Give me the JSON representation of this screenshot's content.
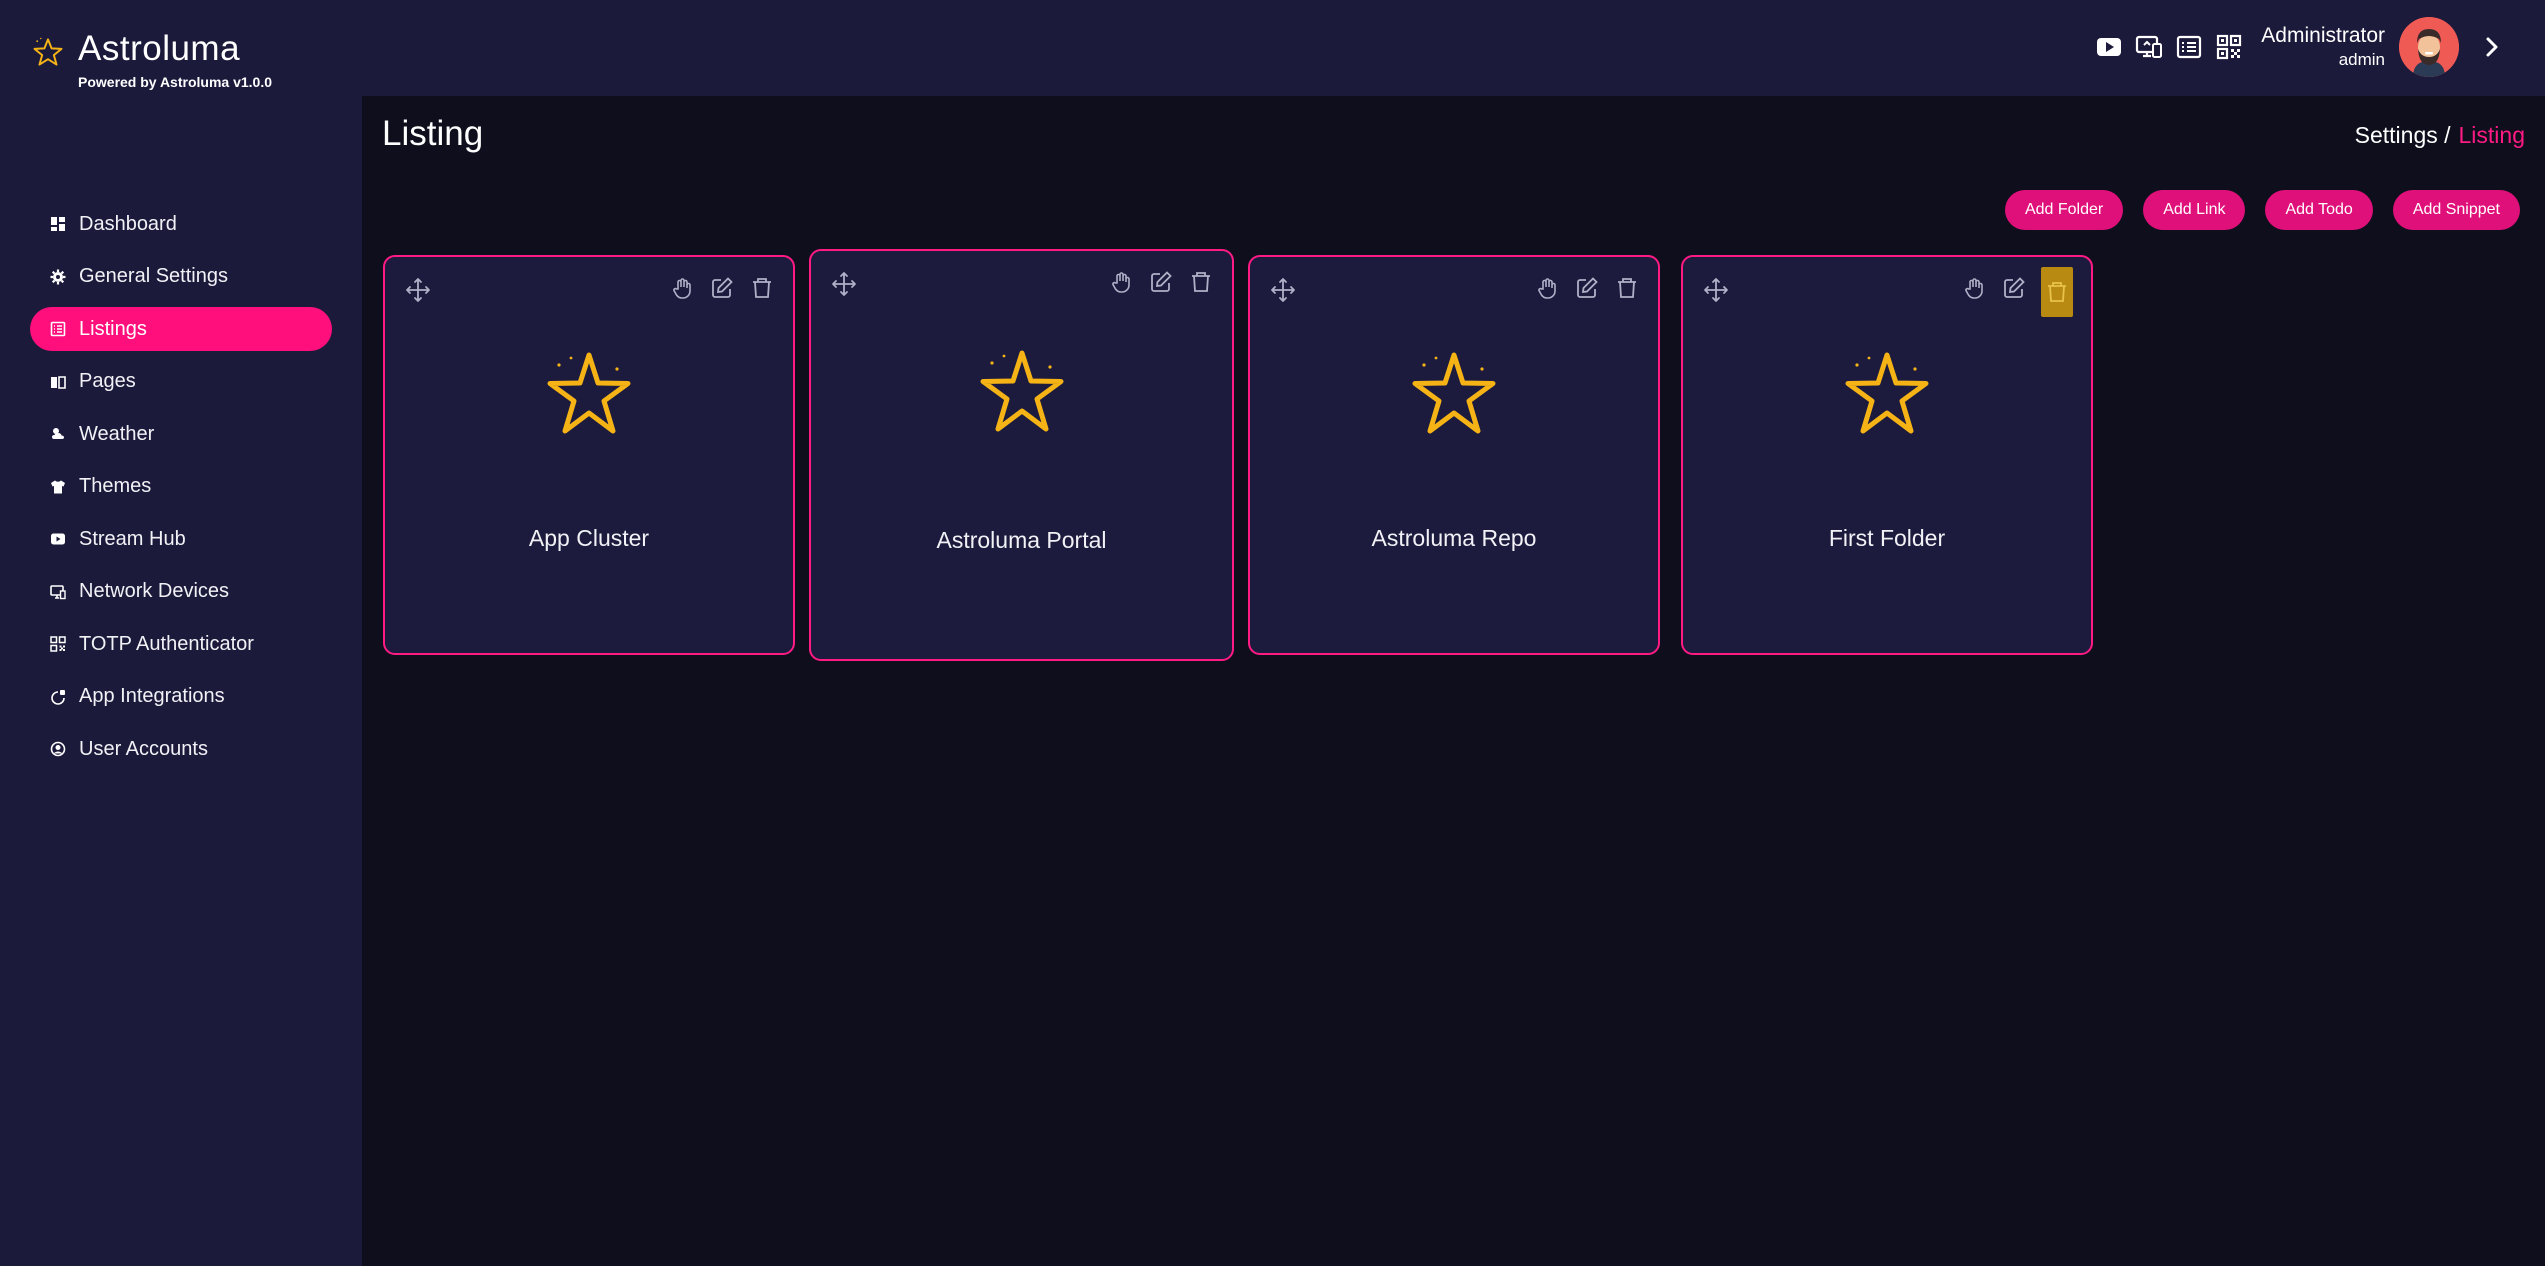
{
  "header": {
    "app_name": "Astroluma",
    "powered_by": "Powered by Astroluma v1.0.0",
    "icons": [
      "youtube-icon",
      "network-devices-icon",
      "listing-icon",
      "qr-code-icon"
    ],
    "user": {
      "name": "Administrator",
      "role": "admin"
    }
  },
  "sidebar": {
    "items": [
      {
        "label": "Dashboard",
        "icon": "dashboard-icon",
        "active": false
      },
      {
        "label": "General Settings",
        "icon": "gear-icon",
        "active": false
      },
      {
        "label": "Listings",
        "icon": "listing-icon",
        "active": true
      },
      {
        "label": "Pages",
        "icon": "pages-icon",
        "active": false
      },
      {
        "label": "Weather",
        "icon": "weather-icon",
        "active": false
      },
      {
        "label": "Themes",
        "icon": "shirt-icon",
        "active": false
      },
      {
        "label": "Stream Hub",
        "icon": "play-icon",
        "active": false
      },
      {
        "label": "Network Devices",
        "icon": "network-devices-icon",
        "active": false
      },
      {
        "label": "TOTP Authenticator",
        "icon": "qr-code-icon",
        "active": false
      },
      {
        "label": "App Integrations",
        "icon": "integration-icon",
        "active": false
      },
      {
        "label": "User Accounts",
        "icon": "user-icon",
        "active": false
      }
    ]
  },
  "main": {
    "title": "Listing",
    "breadcrumb": {
      "parent": "Settings /",
      "current": "Listing"
    },
    "actions": [
      "Add Folder",
      "Add Link",
      "Add Todo",
      "Add Snippet"
    ],
    "cards": [
      {
        "name": "App Cluster"
      },
      {
        "name": "Astroluma Portal"
      },
      {
        "name": "Astroluma Repo"
      },
      {
        "name": "First Folder"
      }
    ]
  },
  "colors": {
    "accent": "#ff0f7b",
    "background": "#0e0e1c",
    "panel": "#1b1a3b",
    "star": "#f5b316"
  }
}
